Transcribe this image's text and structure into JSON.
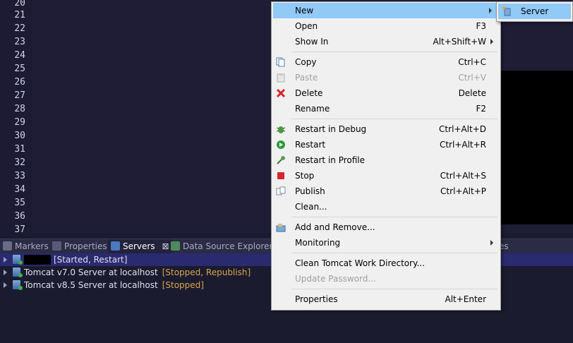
{
  "editor": {
    "line_numbers": [
      "20",
      "21",
      "22",
      "23",
      "24",
      "25",
      "26",
      "27",
      "28",
      "29",
      "30",
      "31",
      "32",
      "33",
      "34",
      "35",
      "36",
      "37"
    ]
  },
  "panel_tabs": [
    {
      "label": "Markers",
      "icon": "markers-icon"
    },
    {
      "label": "Properties",
      "icon": "properties-icon"
    },
    {
      "label": "Servers",
      "icon": "servers-icon",
      "active": true,
      "close": "⊠"
    },
    {
      "label": "Data Source Explorer",
      "icon": "data-source-explorer-icon"
    },
    {
      "label": "es",
      "icon": ""
    }
  ],
  "servers": [
    {
      "name": "",
      "state": "[Started, Restart]",
      "selected": true
    },
    {
      "name": "Tomcat v7.0 Server at localhost",
      "state": "[Stopped, Republish]"
    },
    {
      "name": "Tomcat v8.5 Server at localhost",
      "state": "[Stopped]"
    }
  ],
  "context_menu": {
    "items": [
      {
        "label": "New",
        "shortcut": "",
        "submenu": true,
        "highlighted": true
      },
      {
        "label": "Open",
        "shortcut": "F3"
      },
      {
        "label": "Show In",
        "shortcut": "Alt+Shift+W",
        "submenu": true
      },
      {
        "label": "Copy",
        "shortcut": "Ctrl+C",
        "icon": "copy-icon"
      },
      {
        "label": "Paste",
        "shortcut": "Ctrl+V",
        "icon": "paste-icon",
        "disabled": true
      },
      {
        "label": "Delete",
        "shortcut": "Delete",
        "icon": "delete-icon"
      },
      {
        "label": "Rename",
        "shortcut": "F2"
      },
      {
        "label": "Restart in Debug",
        "shortcut": "Ctrl+Alt+D",
        "icon": "debug-icon"
      },
      {
        "label": "Restart",
        "shortcut": "Ctrl+Alt+R",
        "icon": "restart-icon"
      },
      {
        "label": "Restart in Profile",
        "shortcut": "",
        "icon": "profile-icon"
      },
      {
        "label": "Stop",
        "shortcut": "Ctrl+Alt+S",
        "icon": "stop-icon"
      },
      {
        "label": "Publish",
        "shortcut": "Ctrl+Alt+P",
        "icon": "publish-icon"
      },
      {
        "label": "Clean...",
        "shortcut": ""
      },
      {
        "label": "Add and Remove...",
        "shortcut": "",
        "icon": "add-remove-icon"
      },
      {
        "label": "Monitoring",
        "shortcut": "",
        "submenu": true
      },
      {
        "label": "Clean Tomcat Work Directory...",
        "shortcut": ""
      },
      {
        "label": "Update Password...",
        "shortcut": "",
        "disabled": true
      },
      {
        "label": "Properties",
        "shortcut": "Alt+Enter"
      }
    ]
  },
  "submenu": {
    "items": [
      {
        "label": "Server",
        "icon": "new-server-icon"
      }
    ]
  },
  "colors": {
    "editor_bg": "#1f1d36",
    "menu_bg": "#f0f0f0",
    "menu_highlight": "#91c9f7",
    "server_state": "#d8a64a",
    "selection": "#2a2a70"
  }
}
